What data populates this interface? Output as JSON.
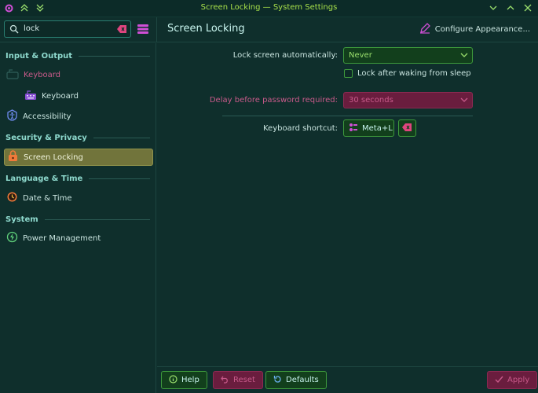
{
  "window": {
    "title": "Screen Locking — System Settings"
  },
  "search": {
    "value": "lock"
  },
  "header": {
    "page_title": "Screen Locking",
    "configure_label": "Configure Appearance..."
  },
  "sidebar": {
    "sections": [
      {
        "label": "Input & Output"
      },
      {
        "label": "Security & Privacy"
      },
      {
        "label": "Language & Time"
      },
      {
        "label": "System"
      }
    ],
    "items": [
      {
        "label": "Keyboard"
      },
      {
        "label": "Keyboard"
      },
      {
        "label": "Accessibility"
      },
      {
        "label": "Screen Locking"
      },
      {
        "label": "Date & Time"
      },
      {
        "label": "Power Management"
      }
    ]
  },
  "settings": {
    "lock_auto_label": "Lock screen automatically:",
    "lock_auto_value": "Never",
    "after_wake_label": "Lock after waking from sleep",
    "delay_label": "Delay before password required:",
    "delay_value": "30 seconds",
    "shortcut_label": "Keyboard shortcut:",
    "shortcut_value": "Meta+L"
  },
  "footer": {
    "help_label": "Help",
    "reset_label": "Reset",
    "defaults_label": "Defaults",
    "apply_label": "Apply"
  },
  "colors": {
    "accent_green": "#9be06d",
    "selected_bg": "#71743b",
    "disabled_magenta": "#c85a8a",
    "background": "#0f2f2c"
  }
}
